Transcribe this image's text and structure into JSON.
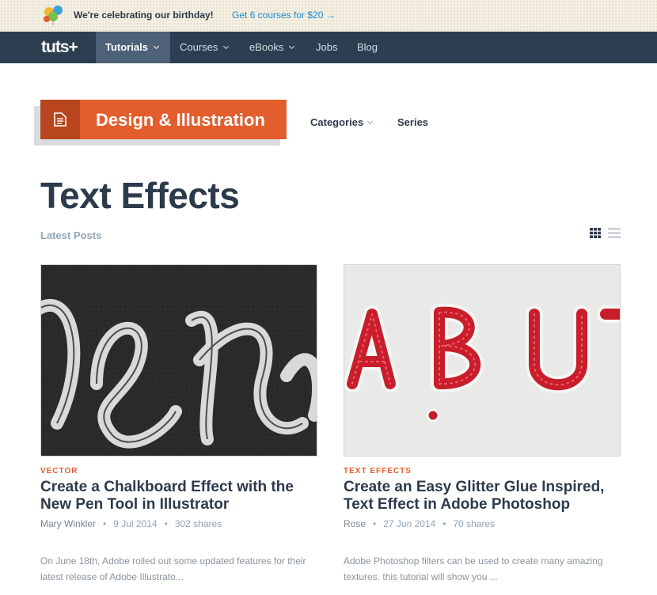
{
  "promo": {
    "text": "We're celebrating our birthday!",
    "link": "Get 6 courses for $20 →"
  },
  "nav": {
    "logo": "tuts+",
    "items": [
      "Tutorials",
      "Courses",
      "eBooks",
      "Jobs",
      "Blog"
    ]
  },
  "category": {
    "title": "Design & Illustration",
    "links": [
      "Categories",
      "Series"
    ]
  },
  "page": {
    "title": "Text Effects",
    "subtitle": "Latest Posts"
  },
  "posts": [
    {
      "category": "VECTOR",
      "title": "Create a Chalkboard Effect with the New Pen Tool in Illustrator",
      "author": "Mary Winkler",
      "date": "9 Jul 2014",
      "shares": "302 shares",
      "excerpt": "On June 18th, Adobe rolled out some updated features for their latest release of Adobe Illustrato..."
    },
    {
      "category": "TEXT EFFECTS",
      "title": "Create an Easy Glitter Glue Inspired, Text Effect in Adobe Photoshop",
      "author": "Rose",
      "date": "27 Jun 2014",
      "shares": "70 shares",
      "excerpt": "Adobe Photoshop filters can be used to create many amazing textures. this tutorial will show you ..."
    }
  ],
  "colors": {
    "nav_bg": "#2c3e50",
    "accent": "#e35d2d",
    "link": "#1e8ad3"
  },
  "icons": [
    "balloons-icon",
    "document-icon",
    "grid-view-icon",
    "list-view-icon",
    "chevron-down-icon"
  ]
}
